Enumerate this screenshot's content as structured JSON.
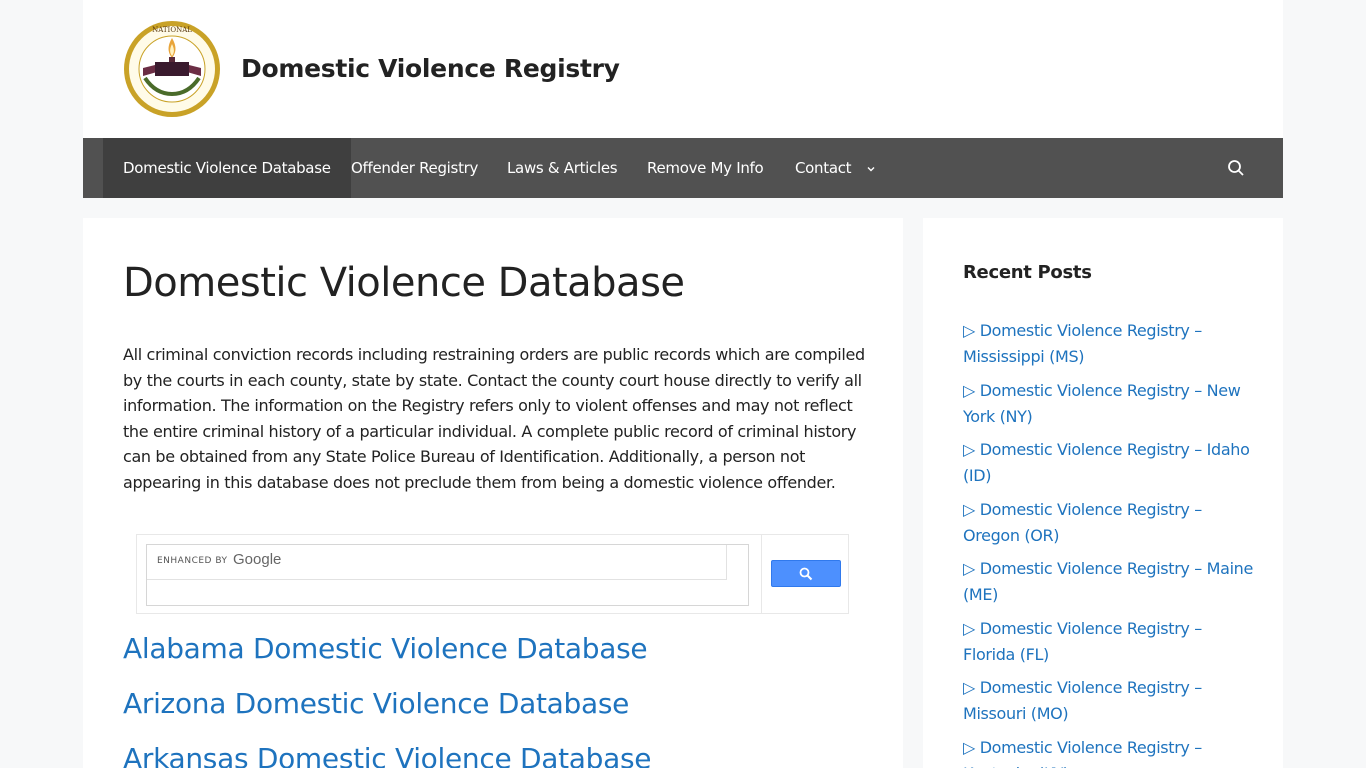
{
  "site": {
    "title": "Domestic Violence Registry",
    "logo_text_top": "NATIONAL",
    "logo_text_bottom": "DOMESTIC VIOLENCE REGISTRY"
  },
  "nav": {
    "items": [
      {
        "label": "Domestic Violence Database",
        "active": true
      },
      {
        "label": "Offender Registry"
      },
      {
        "label": "Laws & Articles"
      },
      {
        "label": "Remove My Info"
      },
      {
        "label": "Contact",
        "has_dropdown": true
      }
    ],
    "search_icon": "search-icon"
  },
  "main": {
    "title": "Domestic Violence Database",
    "intro": "All criminal conviction records including restraining orders are public records which are compiled by the courts in each county, state by state. Contact the county court house directly to verify all information. The information on the Registry refers only to violent offenses and may not reflect the entire criminal history of a particular individual. A complete public record of criminal history can be obtained from any State Police Bureau of Identification. Additionally, a person not appearing in this database does not preclude them from being a domestic violence offender.",
    "search": {
      "enhanced_label": "ENHANCED BY",
      "brand": "Google"
    },
    "state_links": [
      "Alabama Domestic Violence Database",
      "Arizona Domestic Violence Database",
      "Arkansas Domestic Violence Database"
    ]
  },
  "sidebar": {
    "widget_title": "Recent Posts",
    "posts": [
      "▷ Domestic Violence Registry – Mississippi (MS)",
      "▷ Domestic Violence Registry – New York (NY)",
      "▷ Domestic Violence Registry – Idaho (ID)",
      "▷ Domestic Violence Registry – Oregon (OR)",
      "▷ Domestic Violence Registry – Maine (ME)",
      "▷ Domestic Violence Registry – Florida (FL)",
      "▷ Domestic Violence Registry – Missouri (MO)",
      "▷ Domestic Violence Registry – Kentucky (KY)"
    ]
  },
  "colors": {
    "link": "#1e73be",
    "nav_bg": "#515151",
    "nav_active": "#3f3f3f",
    "google_button": "#4d90fe"
  }
}
